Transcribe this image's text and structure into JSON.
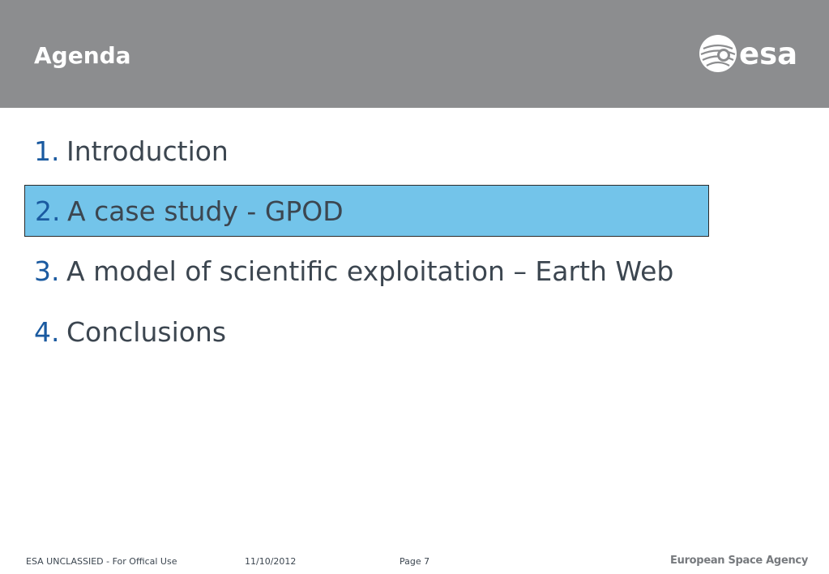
{
  "header": {
    "title": "Agenda",
    "logo_text": "esa",
    "background_color": "#8c8d8f",
    "logo_icon": "esa-logo-icon"
  },
  "agenda": {
    "items": [
      {
        "number": "1.",
        "label": "Introduction",
        "active": false
      },
      {
        "number": "2.",
        "label": "A case study - GPOD",
        "active": true
      },
      {
        "number": "3.",
        "label": "A model of scientific exploitation – Earth Web",
        "active": false
      },
      {
        "number": "4.",
        "label": "Conclusions",
        "active": false
      }
    ],
    "number_color": "#1a5aa0",
    "highlight_color": "#73c4ea"
  },
  "footer": {
    "classification": "ESA UNCLASSIED - For Offical Use",
    "date": "11/10/2012",
    "page": "Page 7",
    "agency": "European Space Agency"
  }
}
